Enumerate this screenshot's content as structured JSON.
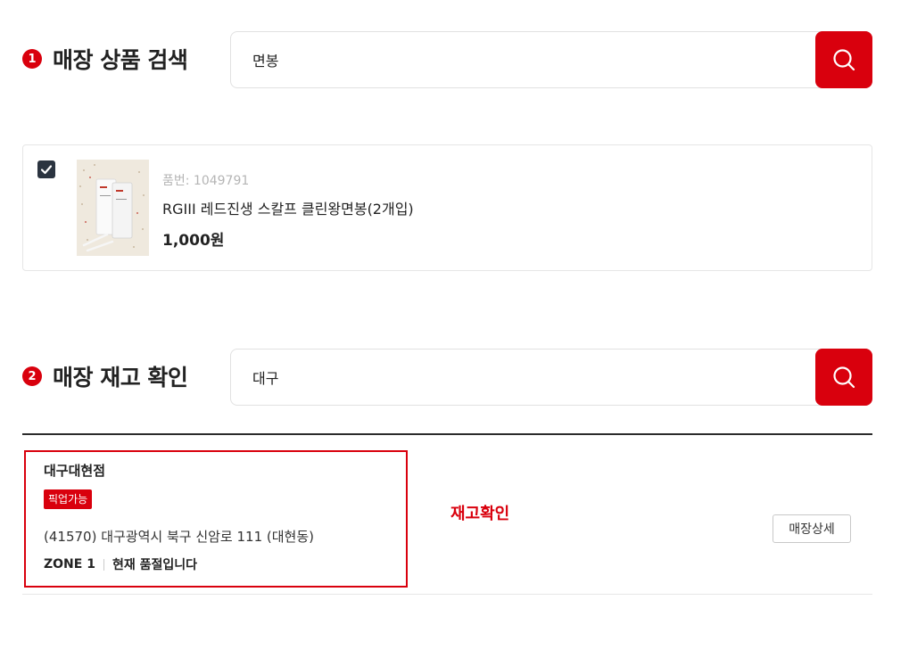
{
  "section1": {
    "number": "1",
    "title": "매장 상품 검색",
    "search_value": "면봉"
  },
  "product": {
    "checked": true,
    "code_label": "품번: 1049791",
    "name": "RGIII 레드진생 스칼프 클린왕면봉(2개입)",
    "price": "1,000원"
  },
  "section2": {
    "number": "2",
    "title": "매장 재고 확인",
    "search_value": "대구"
  },
  "store": {
    "name": "대구대현점",
    "pickup_badge": "픽업가능",
    "address": "(41570) 대구광역시 북구 신암로 111 (대현동)",
    "zone": "ZONE 1",
    "status": "현재 품절입니다",
    "stock_check_label": "재고확인",
    "detail_button": "매장상세"
  },
  "colors": {
    "accent": "#d9000d",
    "checkbox": "#2b3440"
  },
  "icons": {
    "search": "search-icon",
    "check": "check-icon"
  }
}
